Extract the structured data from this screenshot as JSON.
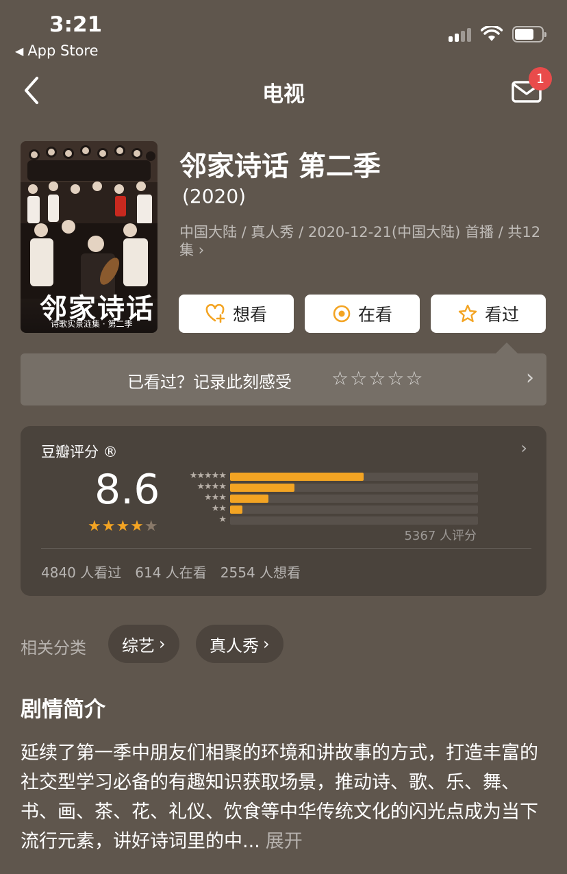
{
  "status_bar": {
    "time": "3:21",
    "back_app": "App Store"
  },
  "nav": {
    "title": "电视",
    "mail_badge": "1"
  },
  "show": {
    "title": "邻家诗话 第二季",
    "year": "(2020)",
    "meta": "中国大陆 / 真人秀 / 2020-12-21(中国大陆) 首播 / 共12集",
    "poster_title": "邻家诗话",
    "poster_subtitle": "诗歌实景涟集 · 第二季"
  },
  "actions": {
    "want": "想看",
    "watching": "在看",
    "watched": "看过"
  },
  "rate_prompt": {
    "text": "已看过？记录此刻感受",
    "stars": "☆☆☆☆☆"
  },
  "score": {
    "label": "豆瓣评分 ®",
    "value": "8.6",
    "stars": "★★★★",
    "half_star": "★",
    "count": "5367 人评分",
    "distribution": [
      {
        "stars": "★★★★★",
        "pct": 0.54
      },
      {
        "stars": "★★★★",
        "pct": 0.26
      },
      {
        "stars": "★★★",
        "pct": 0.155
      },
      {
        "stars": "★★",
        "pct": 0.05
      },
      {
        "stars": "★",
        "pct": 0.0
      }
    ],
    "stats": [
      "4840 人看过",
      "614 人在看",
      "2554 人想看"
    ]
  },
  "related": {
    "label": "相关分类",
    "tags": [
      "综艺",
      "真人秀"
    ]
  },
  "synopsis": {
    "title": "剧情简介",
    "text": "延续了第一季中朋友们相聚的环境和讲故事的方式，打造丰富的社交型学习必备的有趣知识获取场景，推动诗、歌、乐、舞、书、画、茶、花、礼仪、饮食等中华传统文化的闪光点成为当下流行元素，讲好诗词里的中...",
    "more": "展开"
  },
  "colors": {
    "background": "#5f564d",
    "accent": "#f3a423",
    "badge": "#e94b4b"
  }
}
